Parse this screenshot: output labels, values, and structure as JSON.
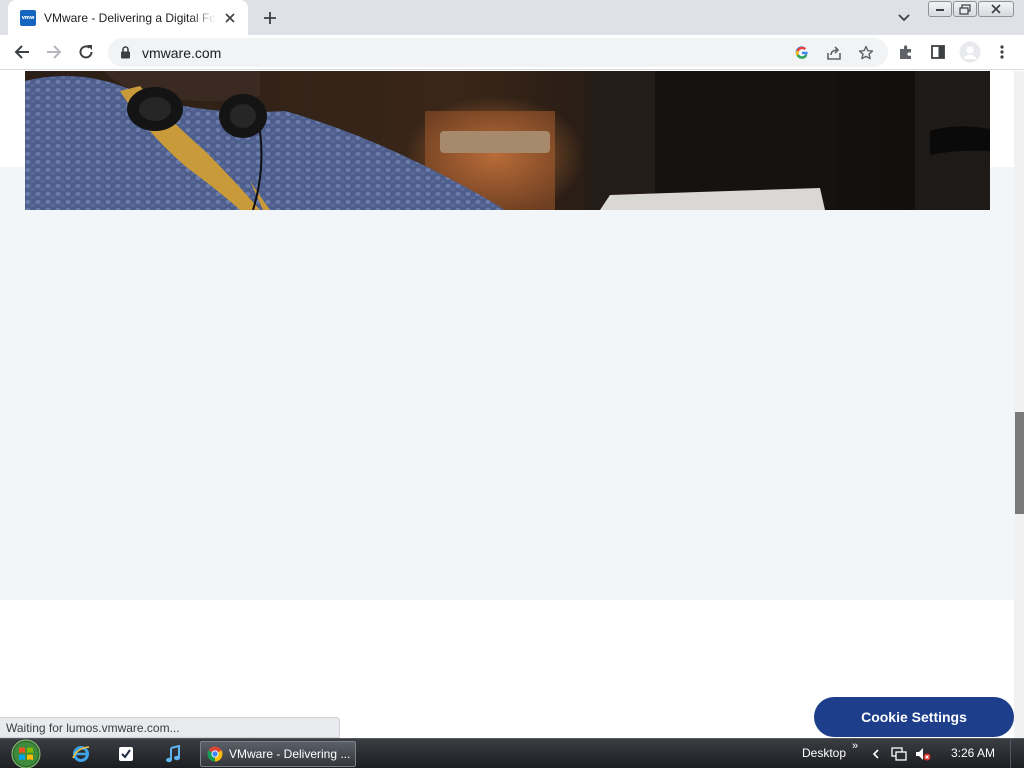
{
  "browser": {
    "tab": {
      "favicon_text": "vmw",
      "title": "VMware - Delivering a Digital Foundation",
      "close_icon": "close-icon"
    },
    "new_tab_icon": "plus-icon",
    "address": {
      "url": "vmware.com"
    },
    "status_text": "Waiting for lumos.vmware.com..."
  },
  "page": {
    "cookie_button_label": "Cookie Settings",
    "background_color": "#f3f6f9",
    "button_color": "#1d3f8b"
  },
  "taskbar": {
    "task_label": "VMware - Delivering ...",
    "desktop_label": "Desktop",
    "overflow_chevron": "»",
    "clock": "3:26 AM"
  }
}
